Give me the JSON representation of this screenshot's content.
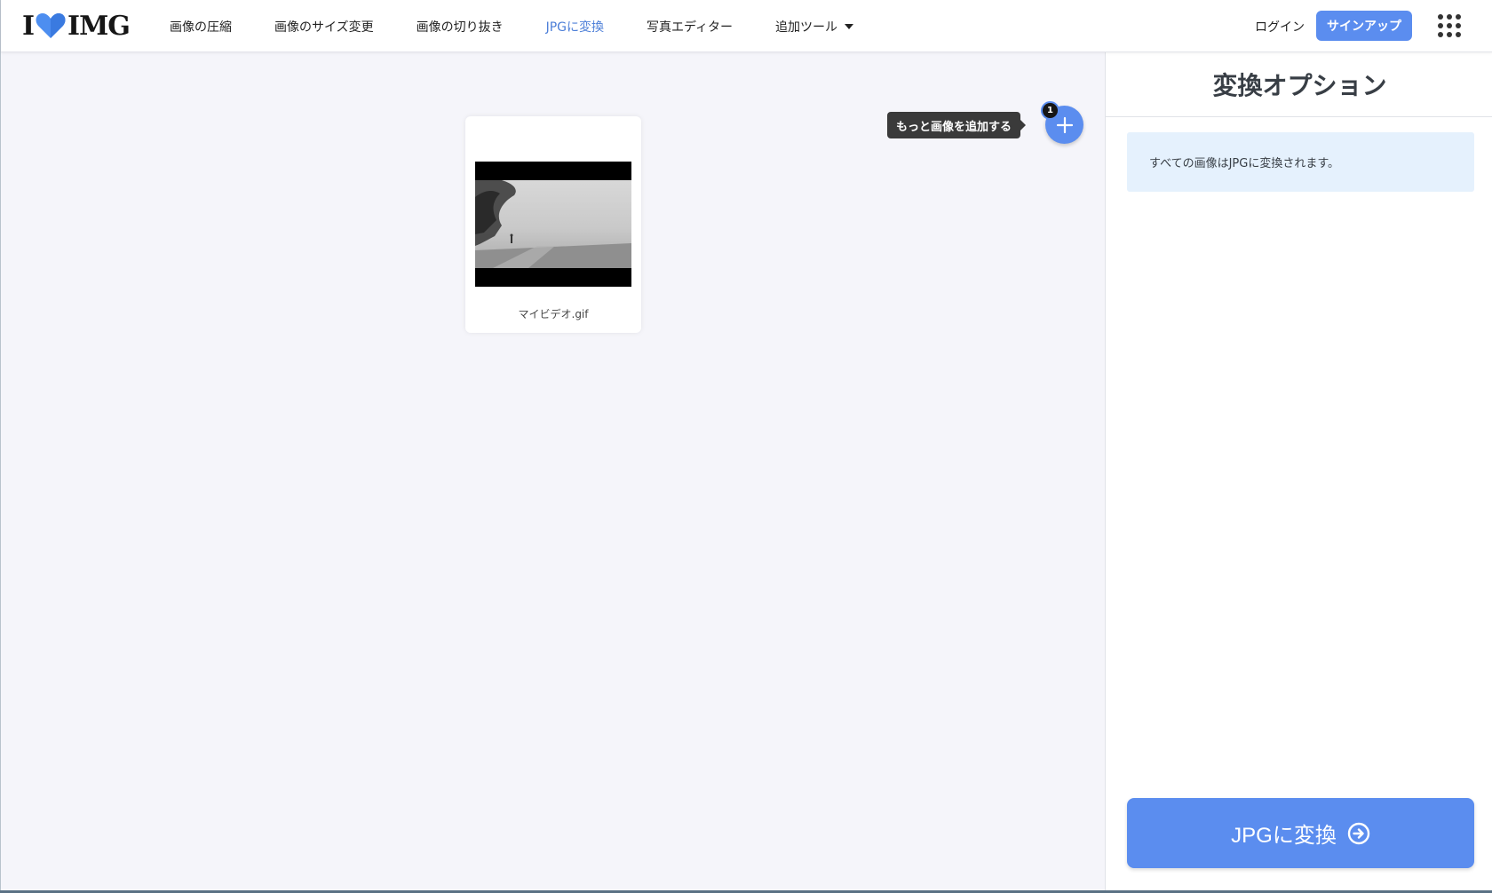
{
  "header": {
    "logo_left": "I",
    "logo_right": "IMG",
    "nav": [
      {
        "label": "画像の圧縮"
      },
      {
        "label": "画像のサイズ変更"
      },
      {
        "label": "画像の切り抜き"
      },
      {
        "label": "JPGに変換",
        "active": true
      },
      {
        "label": "写真エディター"
      },
      {
        "label": "追加ツール"
      }
    ],
    "login_label": "ログイン",
    "signup_label": "サインアップ"
  },
  "workspace": {
    "file": {
      "name": "マイビデオ.gif"
    },
    "add_tooltip": "もっと画像を追加する",
    "add_count": "1"
  },
  "sidebar": {
    "title": "変換オプション",
    "info": "すべての画像はJPGに変換されます。",
    "convert_label": "JPGに変換"
  },
  "colors": {
    "accent": "#5b8def",
    "active_nav": "#4d7fd8",
    "info_bg": "#e5f1fd",
    "workspace_bg": "#f5f5fa"
  }
}
